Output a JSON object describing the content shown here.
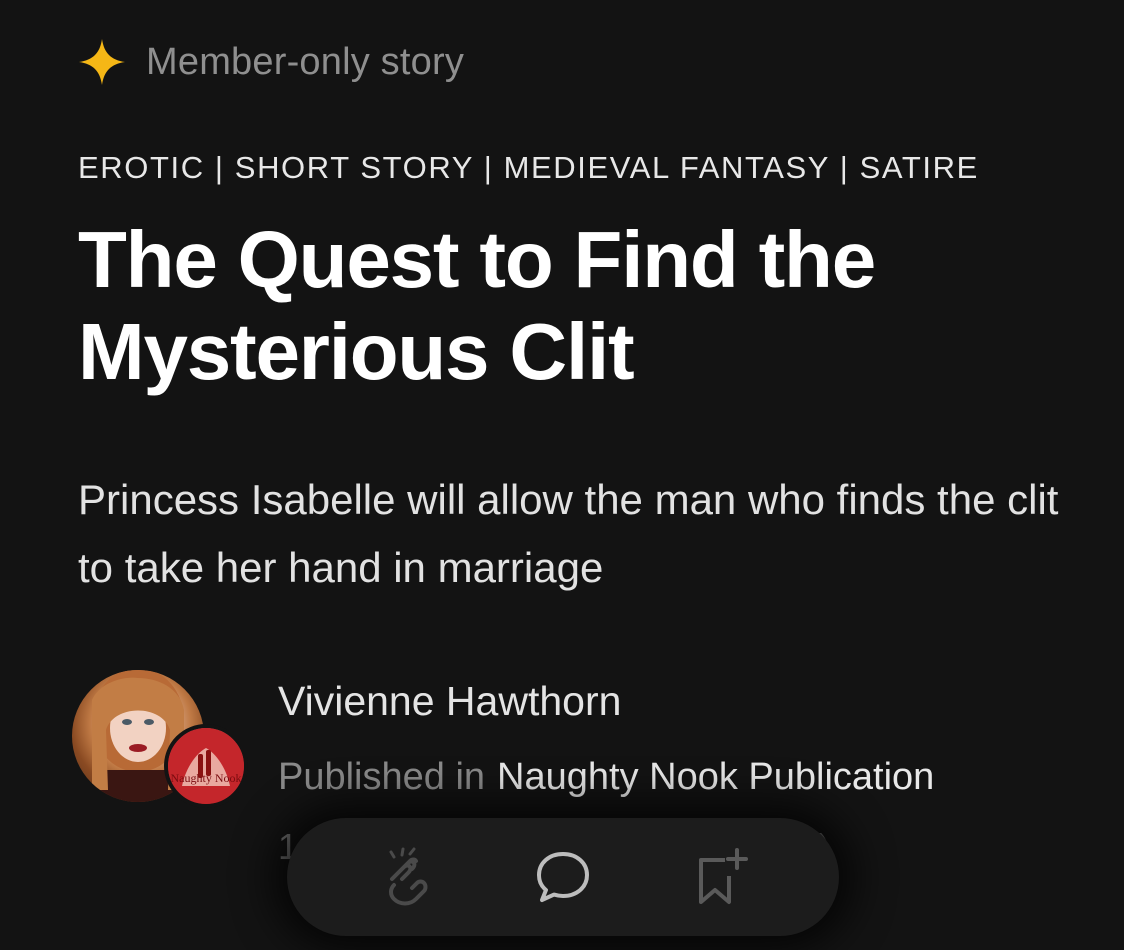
{
  "story": {
    "member_label": "Member-only story",
    "tags": "EROTIC | SHORT STORY | MEDIEVAL FANTASY | SATIRE",
    "title": "The Quest to Find the Mysterious Clit",
    "subtitle": "Princess Isabelle will allow the man who finds the clit to take her hand in marriage"
  },
  "author": {
    "name": "Vivienne Hawthorn",
    "published_prefix": "Published in",
    "publication": "Naughty Nook Publication",
    "publication_logo_text": "Naughty Nook",
    "meta_left_fragment": "1",
    "meta_right_fragment": ")"
  },
  "action_bar": {
    "icons": [
      "clap-icon",
      "comment-icon",
      "bookmark-add-icon"
    ]
  },
  "colors": {
    "background": "#131313",
    "star": "#f5b716",
    "muted_text": "#8f8f8f",
    "action_bar": "#1c1c1c"
  }
}
